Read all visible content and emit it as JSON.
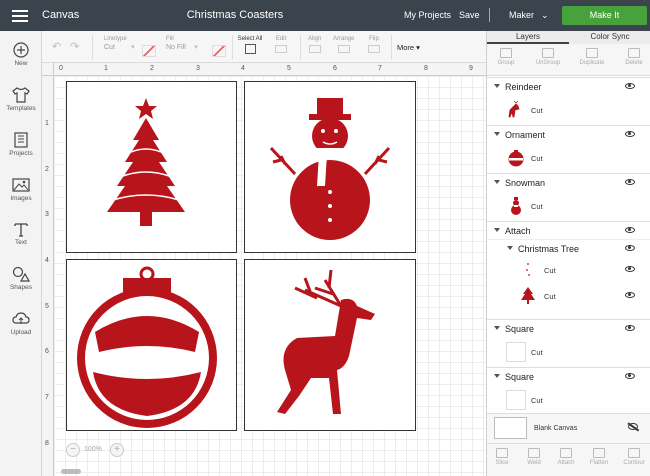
{
  "header": {
    "app_title": "Canvas",
    "doc_title": "Christmas Coasters",
    "my_projects": "My Projects",
    "save": "Save",
    "machine": "Maker",
    "make_it": "Make It"
  },
  "leftnav": {
    "items": [
      {
        "label": "New",
        "icon": "plus-icon"
      },
      {
        "label": "Templates",
        "icon": "tshirt-icon"
      },
      {
        "label": "Projects",
        "icon": "projects-icon"
      },
      {
        "label": "Images",
        "icon": "image-icon"
      },
      {
        "label": "Text",
        "icon": "text-icon"
      },
      {
        "label": "Shapes",
        "icon": "shapes-icon"
      },
      {
        "label": "Upload",
        "icon": "upload-icon"
      }
    ]
  },
  "toolbar": {
    "linetype_label": "Linetype",
    "linetype_value": "Cut",
    "fill_label": "Fill",
    "fill_value": "No Fill",
    "select_all": "Select All",
    "edit": "Edit",
    "align": "Align",
    "arrange": "Arrange",
    "flip": "Flip",
    "more": "More"
  },
  "rulers": {
    "top": [
      "0",
      "1",
      "2",
      "3",
      "4",
      "5",
      "6",
      "7",
      "8",
      "9"
    ],
    "left": [
      "1",
      "2",
      "3",
      "4",
      "5",
      "6",
      "7",
      "8"
    ]
  },
  "canvas": {
    "zoom": "100%",
    "tiles": [
      "Christmas Tree",
      "Snowman",
      "Ornament",
      "Reindeer"
    ]
  },
  "rightpanel": {
    "tabs": [
      "Layers",
      "Color Sync"
    ],
    "tools": [
      "Group",
      "UnGroup",
      "Duplicate",
      "Delete"
    ],
    "layers": [
      {
        "type": "group",
        "title": "Reindeer"
      },
      {
        "type": "item",
        "label": "Cut",
        "thumb": "reindeer"
      },
      {
        "type": "group",
        "title": "Ornament"
      },
      {
        "type": "item",
        "label": "Cut",
        "thumb": "ornament"
      },
      {
        "type": "group",
        "title": "Snowman"
      },
      {
        "type": "item",
        "label": "Cut",
        "thumb": "snowman"
      },
      {
        "type": "group",
        "title": "Attach"
      },
      {
        "type": "subgroup",
        "title": "Christmas Tree"
      },
      {
        "type": "subitem",
        "label": "Cut",
        "thumb": "dots"
      },
      {
        "type": "subitem",
        "label": "Cut",
        "thumb": "tree"
      },
      {
        "type": "group",
        "title": "Square"
      },
      {
        "type": "item",
        "label": "Cut",
        "thumb": "square"
      },
      {
        "type": "group",
        "title": "Square"
      },
      {
        "type": "item",
        "label": "Cut",
        "thumb": "square"
      }
    ],
    "blank_canvas": "Blank Canvas",
    "bottom_tools": [
      "Slice",
      "Weld",
      "Attach",
      "Flatten",
      "Contour"
    ]
  },
  "colors": {
    "header_bg": "#3b434c",
    "make_it": "#47a13d",
    "design_red": "#b8141b"
  }
}
